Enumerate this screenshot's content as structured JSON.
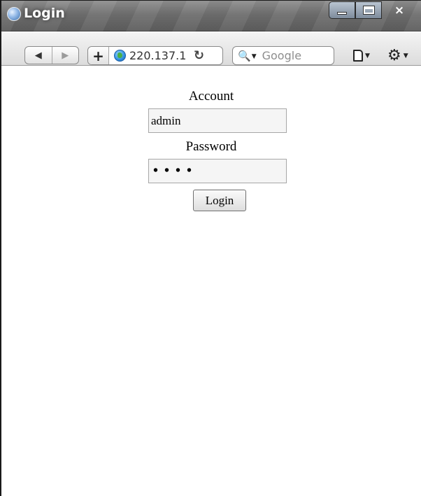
{
  "window": {
    "title": "Login",
    "close_glyph": "×"
  },
  "toolbar": {
    "back_glyph": "◀",
    "forward_glyph": "▶",
    "add_glyph": "+",
    "url": "220.137.1",
    "reload_glyph": "↻",
    "search_glyph": "🔍",
    "search_placeholder": "Google",
    "gear_glyph": "⚙"
  },
  "form": {
    "account_label": "Account",
    "account_value": "admin",
    "password_label": "Password",
    "password_mask": "••••",
    "login_label": "Login"
  },
  "colors": {
    "titlebar": "#6f6f6f",
    "toolbar": "#e6e6e6",
    "field_background": "#f5f5f5"
  }
}
